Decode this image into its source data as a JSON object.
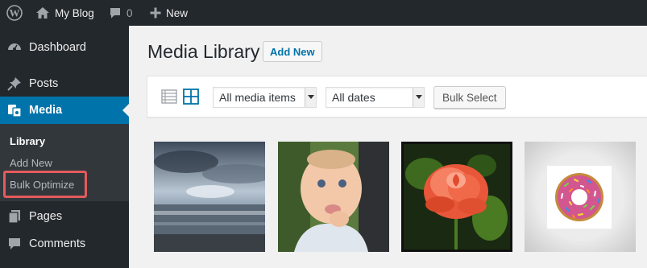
{
  "admin_bar": {
    "site_name": "My Blog",
    "comments_count": "0",
    "new_label": "New"
  },
  "sidebar": {
    "items": [
      {
        "label": "Dashboard",
        "icon": "dashboard-icon"
      },
      {
        "label": "Posts",
        "icon": "pushpin-icon"
      },
      {
        "label": "Media",
        "icon": "media-icon",
        "active": true
      },
      {
        "label": "Pages",
        "icon": "pages-icon"
      },
      {
        "label": "Comments",
        "icon": "comment-icon"
      }
    ],
    "submenu": [
      {
        "label": "Library",
        "current": true
      },
      {
        "label": "Add New"
      },
      {
        "label": "Bulk Optimize",
        "highlighted": true
      }
    ],
    "highlight_color": "#e35b5b"
  },
  "main": {
    "title": "Media Library",
    "add_new_label": "Add New",
    "toolbar": {
      "media_filter": "All media items",
      "date_filter": "All dates",
      "bulk_select_label": "Bulk Select",
      "active_view": "grid"
    },
    "thumbnails": [
      {
        "subject": "ocean sunset"
      },
      {
        "subject": "baby"
      },
      {
        "subject": "rose"
      },
      {
        "subject": "donut"
      }
    ]
  },
  "colors": {
    "admin_dark": "#23282d",
    "accent": "#0073aa",
    "background": "#f1f1f1"
  }
}
